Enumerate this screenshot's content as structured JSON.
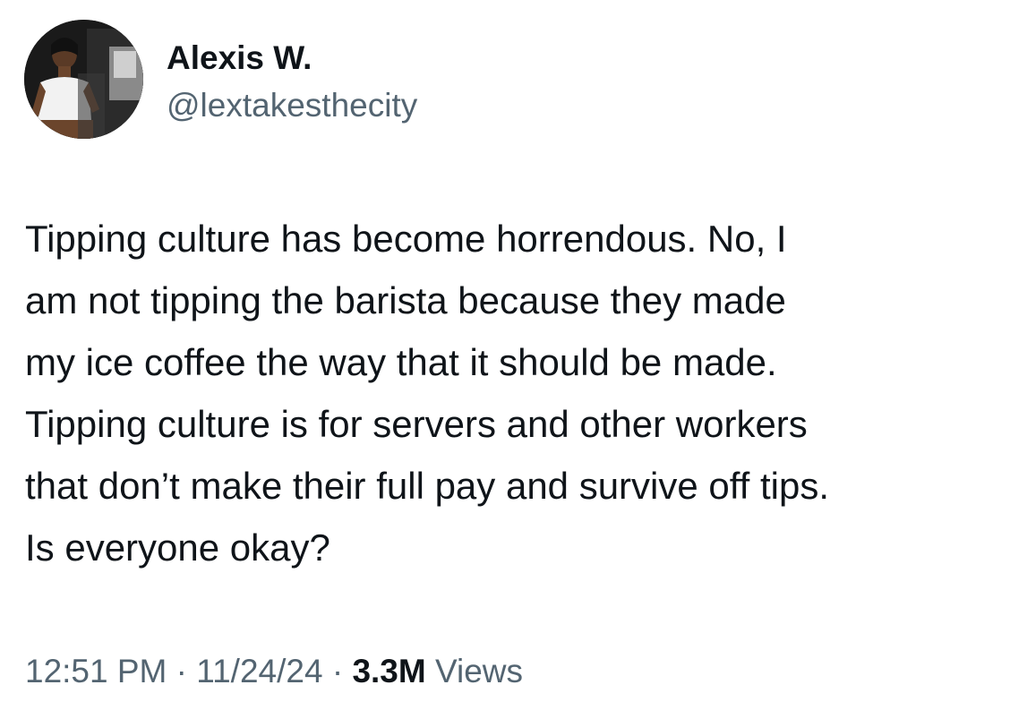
{
  "author": {
    "display_name": "Alexis W.",
    "handle": "@lextakesthecity"
  },
  "tweet": {
    "lines": [
      "Tipping culture has become horrendous. No, I",
      "am not tipping the barista because they made",
      "my ice coffee the way that it should be made.",
      "Tipping culture is for servers and other workers",
      "that don’t make their full pay and survive off tips.",
      "Is everyone okay?"
    ]
  },
  "meta": {
    "time": "12:51 PM",
    "separator": " · ",
    "date": "11/24/24",
    "views_count": "3.3M",
    "views_label": "Views"
  },
  "colors": {
    "text_primary": "#0f1419",
    "text_secondary": "#536471",
    "background": "#ffffff"
  }
}
